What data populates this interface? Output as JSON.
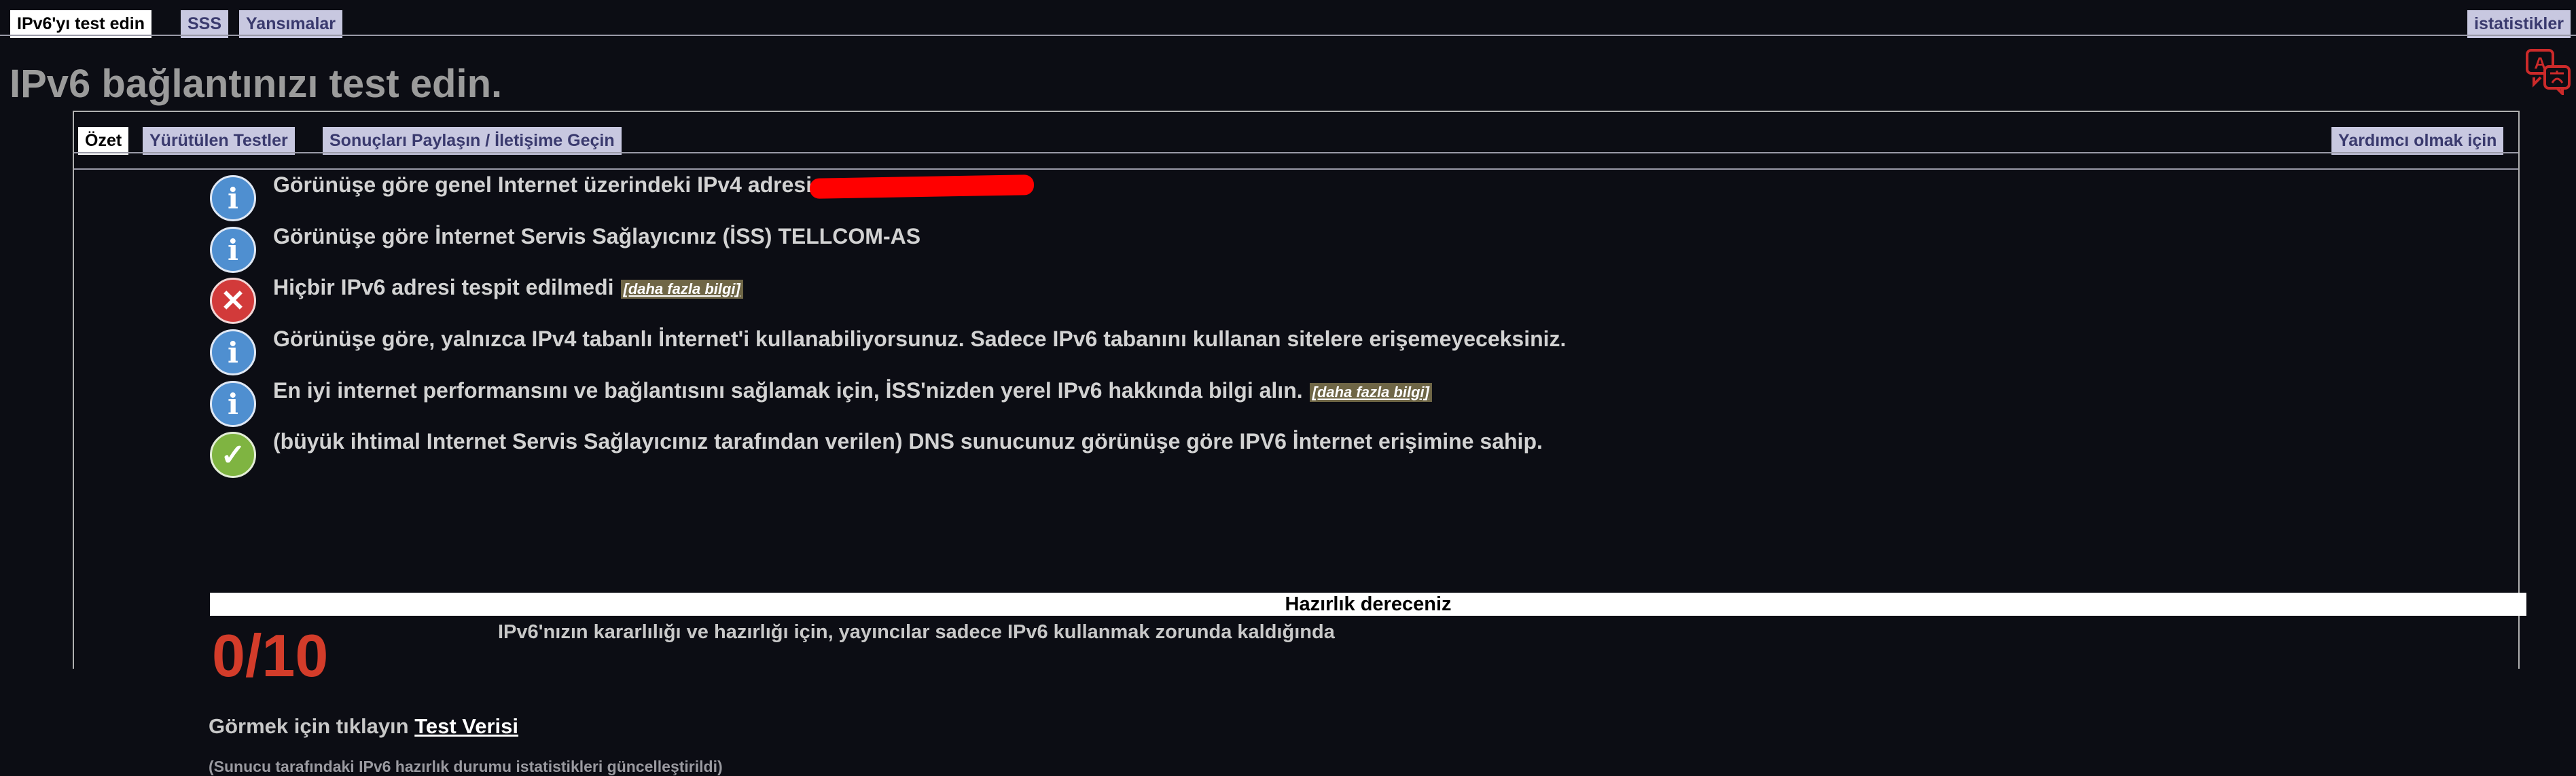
{
  "top_nav": {
    "tabs": [
      "IPv6'yı test edin",
      "SSS",
      "Yansımalar"
    ],
    "stats": "istatistikler"
  },
  "page_title": "IPv6 bağlantınızı test edin.",
  "sub_nav": {
    "tabs": [
      "Özet",
      "Yürütülen Testler",
      "Sonuçları Paylaşın / İletişime Geçin"
    ],
    "help": "Yardımcı olmak için"
  },
  "results": [
    {
      "icon": "info-icon",
      "text": "Görünüşe göre genel Internet üzerindeki IPv4 adresi:",
      "more": ""
    },
    {
      "icon": "info-icon",
      "text": "Görünüşe göre İnternet Servis Sağlayıcınız (İSS) TELLCOM-AS",
      "more": ""
    },
    {
      "icon": "error-icon",
      "text": "Hiçbir IPv6 adresi tespit edilmedi",
      "more": "[daha fazla bilgi]"
    },
    {
      "icon": "info-icon",
      "text": "Görünüşe göre, yalnızca IPv4 tabanlı İnternet'i kullanabiliyorsunuz. Sadece IPv6 tabanını kullanan sitelere erişemeyeceksiniz.",
      "more": ""
    },
    {
      "icon": "info-icon",
      "text": "En iyi internet performansını ve bağlantısını sağlamak için, İSS'nizden yerel IPv6 hakkında bilgi alın.",
      "more": "[daha fazla bilgi]"
    },
    {
      "icon": "check-icon",
      "text": "(büyük ihtimal Internet Servis Sağlayıcınız tarafından verilen) DNS sunucunuz görünüşe göre IPV6 İnternet erişimine sahip.",
      "more": ""
    }
  ],
  "readiness": {
    "heading": "Hazırlık dereceniz",
    "score": "0/10",
    "note": "IPv6'nızın kararlılığı ve hazırlığı için, yayıncılar sadece IPv6 kullanmak zorunda kaldığında"
  },
  "test_data": {
    "prefix": "Görmek için tıklayın",
    "link": "Test Verisi"
  },
  "server_note": "(Sunucu tarafındaki IPv6 hazırlık durumu istatistikleri güncelleştirildi)",
  "colors": {
    "background": "#0c0d14",
    "info": "#4f8fd0",
    "error": "#d23a3a",
    "ok": "#7fb441",
    "score": "#d33c2a",
    "redaction": "#ff0000"
  }
}
